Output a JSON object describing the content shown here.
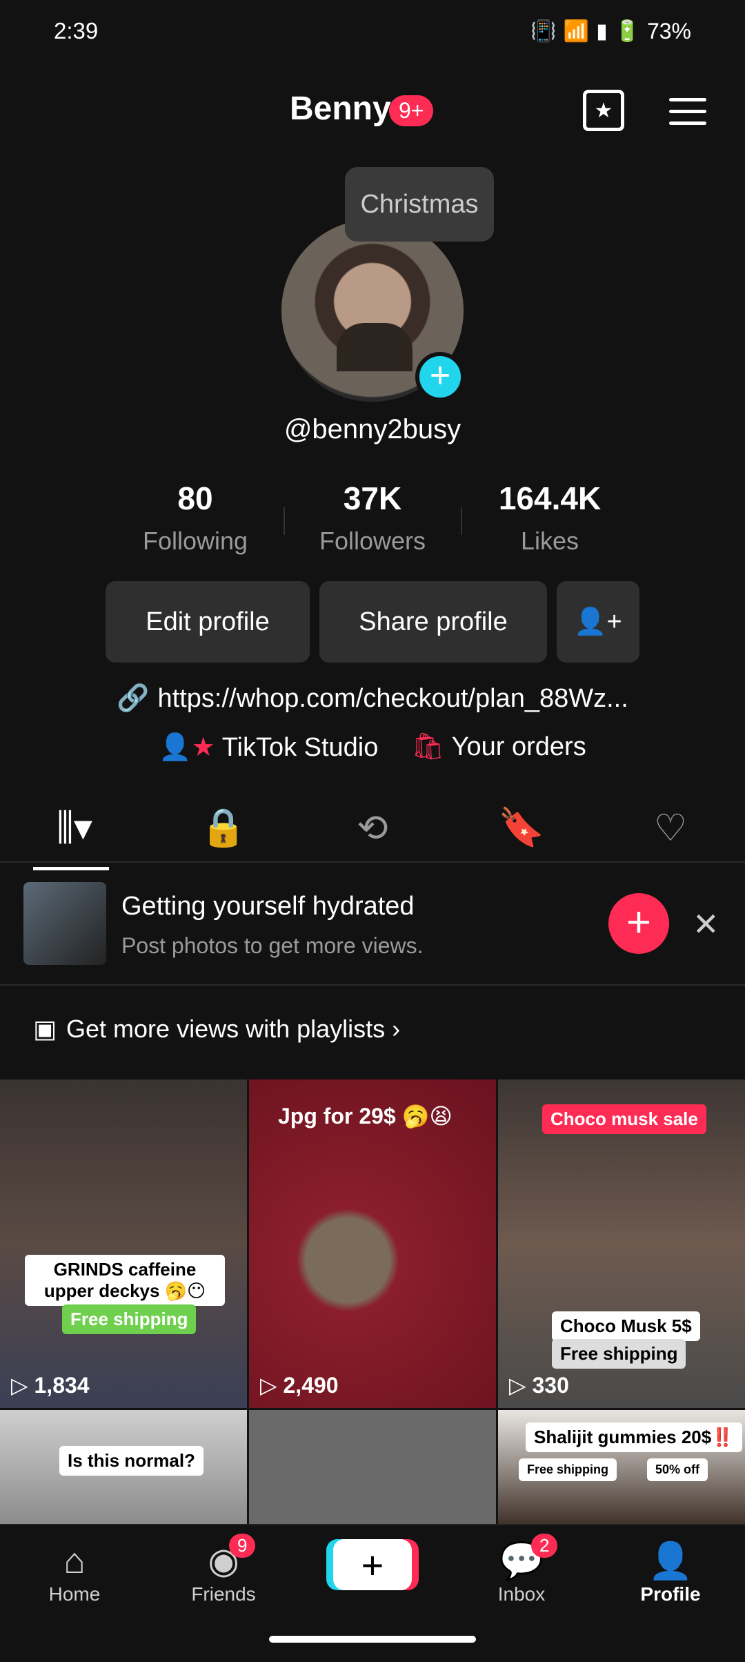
{
  "status": {
    "time": "2:39",
    "battery": "73%"
  },
  "header": {
    "title": "Benny",
    "badge": "9+"
  },
  "tooltip": "Christmas",
  "profile": {
    "username": "@benny2busy"
  },
  "stats": [
    {
      "value": "80",
      "label": "Following"
    },
    {
      "value": "37K",
      "label": "Followers"
    },
    {
      "value": "164.4K",
      "label": "Likes"
    }
  ],
  "buttons": {
    "edit": "Edit profile",
    "share": "Share profile"
  },
  "link": "https://whop.com/checkout/plan_88Wz...",
  "extras": {
    "studio": "TikTok Studio",
    "orders": "Your orders"
  },
  "promo": {
    "title": "Getting yourself hydrated",
    "subtitle": "Post photos to get more views."
  },
  "playlists": "Get more views with playlists",
  "grid": [
    {
      "caption1": "GRINDS caffeine upper deckys 🥱😶",
      "caption2": "Free shipping",
      "views": "1,834"
    },
    {
      "caption1": "Jpg for 29$ 🥱😫",
      "views": "2,490"
    },
    {
      "caption1": "Choco musk sale",
      "caption2": "Choco Musk 5$",
      "caption3": "Free shipping",
      "views": "330"
    },
    {
      "caption1": "Is this normal?"
    },
    {},
    {
      "caption1": "Shalijit gummies 20$‼️",
      "caption2": "Free shipping",
      "caption3": "50% off"
    }
  ],
  "nav": {
    "home": "Home",
    "friends": "Friends",
    "friends_badge": "9",
    "inbox": "Inbox",
    "inbox_badge": "2",
    "profile": "Profile"
  }
}
